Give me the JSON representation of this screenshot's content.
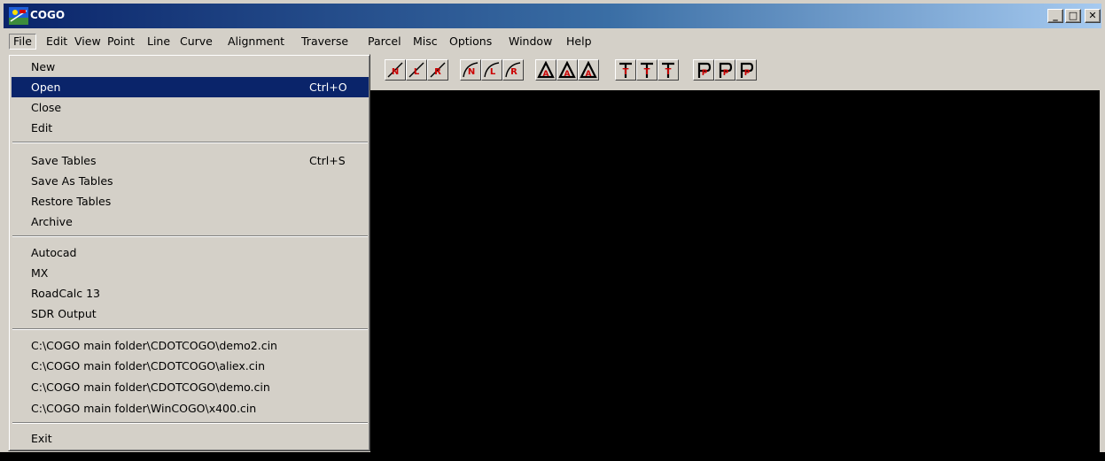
{
  "window": {
    "title": "COGO",
    "minimize_label": "_",
    "maximize_label": "□",
    "close_label": "✕"
  },
  "menubar": [
    {
      "label": "File",
      "active": true
    },
    {
      "label": "Edit"
    },
    {
      "label": "View"
    },
    {
      "label": "Point"
    },
    {
      "label": "Line"
    },
    {
      "label": "Curve"
    },
    {
      "label": "Alignment"
    },
    {
      "label": "Traverse"
    },
    {
      "label": "Parcel"
    },
    {
      "label": "Misc"
    },
    {
      "label": "Options"
    },
    {
      "label": "Window"
    },
    {
      "label": "Help"
    }
  ],
  "file_menu": {
    "items": [
      {
        "label": "New",
        "shortcut": ""
      },
      {
        "label": "Open",
        "shortcut": "Ctrl+O",
        "highlighted": true
      },
      {
        "label": "Close",
        "shortcut": ""
      },
      {
        "label": "Edit",
        "shortcut": ""
      },
      {
        "label": "Save Tables",
        "shortcut": "Ctrl+S"
      },
      {
        "label": "Save As Tables",
        "shortcut": ""
      },
      {
        "label": "Restore Tables",
        "shortcut": ""
      },
      {
        "label": "Archive",
        "shortcut": ""
      },
      {
        "label": "Autocad",
        "shortcut": ""
      },
      {
        "label": "MX",
        "shortcut": ""
      },
      {
        "label": "RoadCalc 13",
        "shortcut": ""
      },
      {
        "label": "SDR Output",
        "shortcut": ""
      },
      {
        "label": "C:\\COGO main folder\\CDOTCOGO\\demo2.cin",
        "shortcut": ""
      },
      {
        "label": "C:\\COGO main folder\\CDOTCOGO\\aliex.cin",
        "shortcut": ""
      },
      {
        "label": "C:\\COGO main folder\\CDOTCOGO\\demo.cin",
        "shortcut": ""
      },
      {
        "label": "C:\\COGO main folder\\WinCOGO\\x400.cin",
        "shortcut": ""
      },
      {
        "label": "Exit",
        "shortcut": ""
      }
    ]
  },
  "toolbar": {
    "buttons": [
      {
        "icon": "line-n-icon",
        "letter": "N"
      },
      {
        "icon": "line-l-icon",
        "letter": "L"
      },
      {
        "icon": "line-r-icon",
        "letter": "R"
      },
      {
        "icon": "curve-n-icon",
        "letter": "N"
      },
      {
        "icon": "curve-l-icon",
        "letter": "L"
      },
      {
        "icon": "curve-r-icon",
        "letter": "R"
      },
      {
        "icon": "alignment-a1-icon",
        "letter": "A"
      },
      {
        "icon": "alignment-a2-icon",
        "letter": "A"
      },
      {
        "icon": "alignment-a3-icon",
        "letter": "A"
      },
      {
        "icon": "traverse-t1-icon",
        "letter": "T"
      },
      {
        "icon": "traverse-t2-icon",
        "letter": "T"
      },
      {
        "icon": "traverse-t3-icon",
        "letter": "T"
      },
      {
        "icon": "parcel-p1-icon",
        "letter": "P"
      },
      {
        "icon": "parcel-p2-icon",
        "letter": "P"
      },
      {
        "icon": "parcel-p3-icon",
        "letter": "P"
      }
    ]
  },
  "colors": {
    "titlebar_start": "#0a246a",
    "titlebar_end": "#a6caf0",
    "highlight": "#0a246a",
    "canvas": "#000000",
    "icon_red": "#cc0000"
  }
}
